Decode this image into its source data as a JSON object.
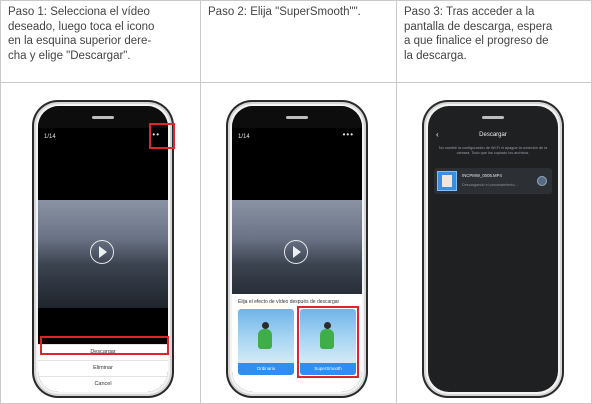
{
  "steps": [
    {
      "text_lines": [
        "Paso 1: Selecciona el vídeo",
        "deseado, luego toca el icono",
        "en la esquina superior dere-",
        "cha y elige \"Descargar\"."
      ]
    },
    {
      "text_lines": [
        "Paso 2: Elija \"SuperSmooth\"\"."
      ]
    },
    {
      "text_lines": [
        "Paso 3: Tras acceder a la",
        "pantalla de descarga, espera",
        "a que finalice el progreso de",
        "la descarga."
      ]
    }
  ],
  "phone1": {
    "counter": "1/14",
    "menu_icon": "more-dots-icon",
    "sheet_items": [
      "Descargar",
      "Eliminar",
      "Cancel"
    ]
  },
  "phone2": {
    "counter": "1/14",
    "dialog_title": "Elija el efecto de vídeo después de descargar",
    "options": [
      "Ordinario",
      "SuperSmooth"
    ]
  },
  "phone3": {
    "title": "Descargar",
    "note": "No cambie la configuración de Wi-Fi ni apague la conexión de la cámara. Todo que los copiado los archivos.",
    "file_name": "INCPMW_0005.MP4",
    "file_status": "Descargando el procesamiento...",
    "back_icon": "back-chevron-icon"
  },
  "colors": {
    "highlight": "#e0242b",
    "accent_blue": "#2f8ff0"
  }
}
